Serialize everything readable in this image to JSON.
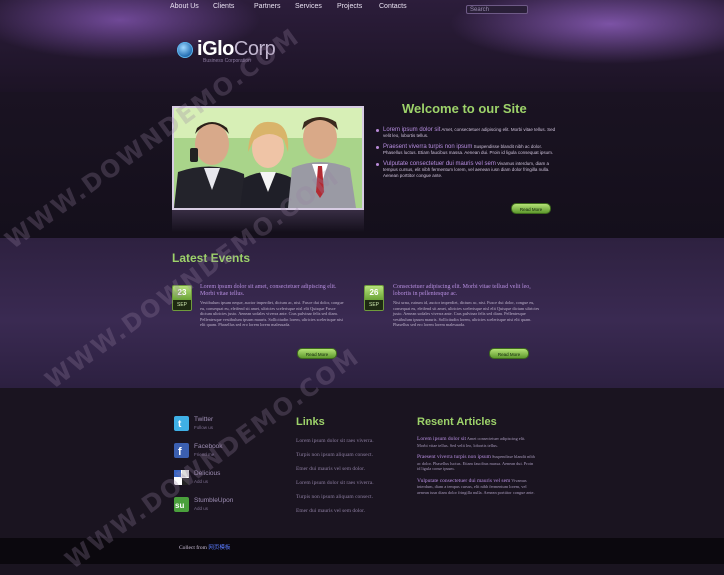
{
  "nav": {
    "items": [
      "About Us",
      "Clients",
      "Partners",
      "Services",
      "Projects",
      "Contacts"
    ]
  },
  "search": {
    "placeholder": "Search"
  },
  "logo": {
    "part1": "i",
    "part2": "Glo",
    "part3": "Corp",
    "tagline": "Business Corporation"
  },
  "welcome": {
    "title": "Welcome to our Site",
    "items": [
      {
        "lead": "Lorem ipsum dolor sit",
        "text": "Amet, consectetuer adipiscing elit. Morbi vitae tellus. Sed velit leo, lobortis tellus."
      },
      {
        "lead": "Praesent viverra turpis non ipsum",
        "text": "Suspendisse blandit nibh ac dolor. Phasellus luctus. Etiam faucibus massa. Aenean dui. Proin id ligula consequat ipsum."
      },
      {
        "lead": "Vulputate consectetuer dui mauris vel sem",
        "text": "Vivamus interdum, diam a tempus cursus, elit nibh fermentum lorem, vel aenean iusn diam dolor fringilla nulla. Aenean porttitor congue ante."
      }
    ],
    "read_more": "Read More"
  },
  "events": {
    "title": "Latest Events",
    "items": [
      {
        "day": "23",
        "month": "SEP",
        "heading": "Lorem ipsum dolor sit amet, consectetuer adipiscing elit. Morbi vitae tellus.",
        "body": "Vestibulum ipsum neque, auctor imperdiet, dictum ac, nisi. Fusce dui dolor, congue eu, consequat eu, eleifend sit amet, ultricies scelerisque nisl elit Quisque Fusce dictum ultricies justo. Aenean sodales viverra ante. Cras pulvinar felis sed diam. Pellentesque vestibulum ipsum mauris. Sollicitudin lorem, ultricies scelerisque nisi elit quam. Phasellus sed ero lorem lorem malesuada.",
        "read_more": "Read More"
      },
      {
        "day": "26",
        "month": "SEP",
        "heading": "Consectetuer adipiscing elit. Morbi vitae tellusd velit leo, lobortis in pellentesque ac.",
        "body": "Nisi urna, rutrum id, auctor imperdiet, dictum ac, nisi. Fusce dui dolor, congue eu, consequat eu, eleifend sit amet, ultricies scelerisque nisl elit Quisque dictum ultricies justo. Aenean sodales viverra ante. Cras pulvinar felis sed diam. Pellentesque vestibulum ipsum mauris. Sollicitudin lorem, ultricies scelerisque nisi elit quam. Phasellus sed ero lorem lorem malesuada.",
        "read_more": "Read More"
      }
    ]
  },
  "social": [
    {
      "name": "Twitter",
      "sub": "Follow us",
      "color": "#3fb0e6"
    },
    {
      "name": "Facebook",
      "sub": "Friend me",
      "color": "#3b5fb0"
    },
    {
      "name": "Delicious",
      "sub": "Add us",
      "color": "#ffffff"
    },
    {
      "name": "StumbleUpon",
      "sub": "Add us",
      "color": "#4aa03c"
    }
  ],
  "links": {
    "title": "Links",
    "items": [
      "Lorem ipsum dolor sit raes viverra.",
      "Turpis non ipsum aliquam consect.",
      "Etner dui mauris vel sem dolor.",
      "Lorem ipsum dolor sit raes viverra.",
      "Turpis non ipsum aliquam consect.",
      "Etner dui mauris vel sem dolor."
    ]
  },
  "articles": {
    "title": "Resent Articles",
    "items": [
      {
        "lead": "Lorem ipsum dolor sit",
        "text": "Amet consectetuer adipiscing elit. Morbi vitae tellus. Sed velit leo, lobortis tellus."
      },
      {
        "lead": "Praesent viverra turpis non ipsum",
        "text": "Suspendisse blandit nibh ac dolor. Phasellus luctus. Etiam faucibus massa. Aenean dui. Proin id ligula conse ipsum."
      },
      {
        "lead": "Vulputate consectetuer dui mauris vel sem",
        "text": "Vivamus interdum, diam a tempus cursus, elit nibh fermentum lorem, vel aenean iusn diam dolor fringilla nulla. Aenean porttitor congue ante."
      }
    ]
  },
  "footer": {
    "collect_prefix": "Collect from",
    "collect_link": "网页模板"
  },
  "watermark": "WWW.DOWNDEMO.COM",
  "colors": {
    "accent_green": "#9dd26a",
    "purple_text": "#b78ee0",
    "background": "#1a1420"
  }
}
